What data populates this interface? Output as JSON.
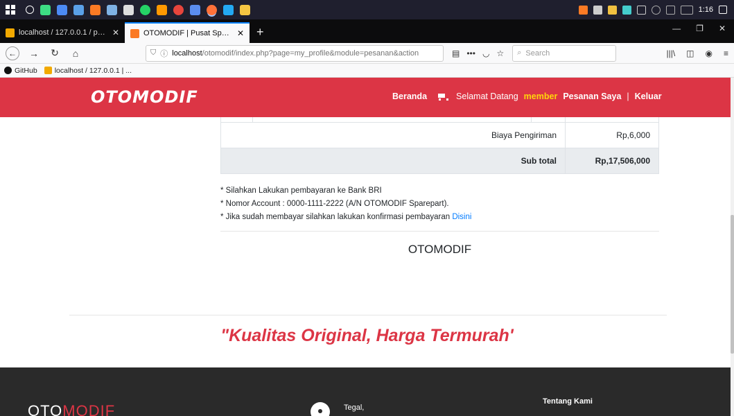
{
  "taskbar": {
    "clock": "1:16",
    "apps": [
      "search-icon",
      "android-icon",
      "edge-icon",
      "chrome-icon",
      "xampp-icon",
      "notes-icon",
      "chat-icon",
      "whatsapp-icon",
      "sublime-icon",
      "chrome2-icon",
      "shield-icon",
      "firefox-icon",
      "vscode-icon",
      "files-icon"
    ]
  },
  "browser": {
    "tabs": [
      {
        "title": "localhost / 127.0.0.1 / phbweb2",
        "active": false
      },
      {
        "title": "OTOMODIF | Pusat Sparepart M",
        "active": true
      }
    ],
    "url_prefix": "localhost",
    "url_path": "/otomodif/index.php?page=my_profile&module=pesanan&action",
    "search_placeholder": "Search",
    "bookmarks": [
      "GitHub",
      "localhost / 127.0.0.1 | ..."
    ]
  },
  "site": {
    "logo": "OTOMODIF",
    "nav": {
      "beranda": "Beranda",
      "welcome": "Selamat Datang",
      "user": "member",
      "orders": "Pesanan Saya",
      "divider": "|",
      "logout": "Keluar"
    }
  },
  "order": {
    "shipping_label": "Biaya Pengiriman",
    "shipping_value": "Rp,6,000",
    "subtotal_label": "Sub total",
    "subtotal_value": "Rp,17,506,000"
  },
  "notes": {
    "line1": "* Silahkan Lakukan pembayaran ke Bank BRI",
    "line2": "* Nomor Account : 0000-1111-2222 (A/N OTOMODIF Sparepart).",
    "line3": "* Jika sudah membayar silahkan lakukan konfirmasi pembayaran",
    "link": "Disini"
  },
  "brand_center": "OTOMODIF",
  "tagline": "\"Kualitas Original, Harga Termurah'",
  "footer": {
    "logo_white": "OTO",
    "logo_red": "MODIF",
    "address": "Tegal,",
    "about": "Tentang Kami"
  }
}
